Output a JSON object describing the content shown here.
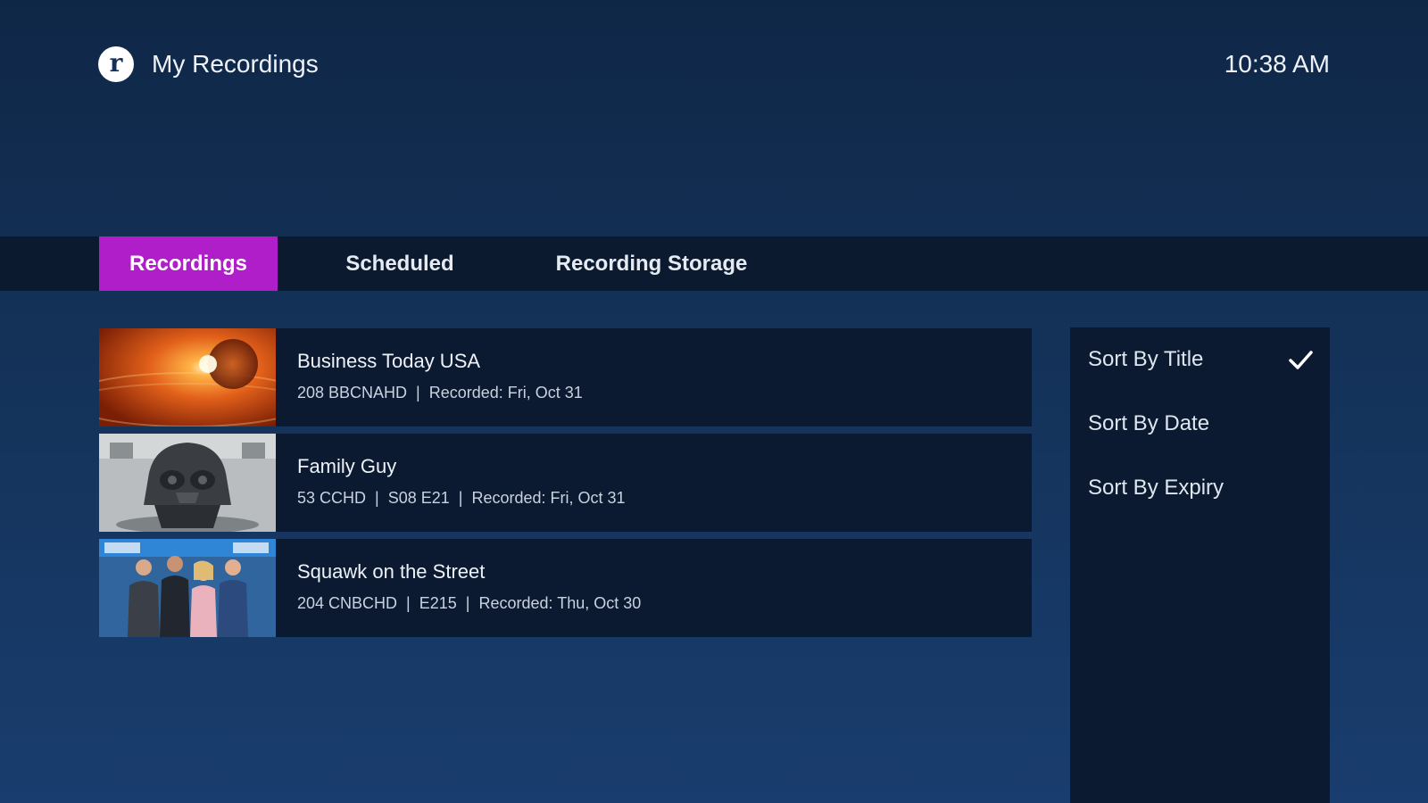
{
  "header": {
    "logo_letter": "r",
    "title": "My Recordings",
    "time": "10:38 AM"
  },
  "tabs": [
    {
      "label": "Recordings",
      "active": true
    },
    {
      "label": "Scheduled",
      "active": false
    },
    {
      "label": "Recording Storage",
      "active": false
    }
  ],
  "recordings": [
    {
      "title": "Business Today USA",
      "channel": "208 BBCNAHD",
      "episode": "",
      "recorded": "Recorded: Fri, Oct 31",
      "thumbnail": "orange-globe-thumbnail"
    },
    {
      "title": "Family Guy",
      "channel": "53 CCHD",
      "episode": "S08 E21",
      "recorded": "Recorded: Fri, Oct 31",
      "thumbnail": "cartoon-helmet-thumbnail"
    },
    {
      "title": "Squawk on the Street",
      "channel": "204 CNBCHD",
      "episode": "E215",
      "recorded": "Recorded: Thu, Oct 30",
      "thumbnail": "news-anchors-thumbnail"
    }
  ],
  "sort_options": [
    {
      "label": "Sort By Title",
      "selected": true
    },
    {
      "label": "Sort By Date",
      "selected": false
    },
    {
      "label": "Sort By Expiry",
      "selected": false
    }
  ],
  "colors": {
    "accent": "#b01ec9",
    "background_top": "#0f2747",
    "background_bottom": "#193d6e",
    "panel": "#0b1a30",
    "tabbar": "#0c1a2f"
  }
}
